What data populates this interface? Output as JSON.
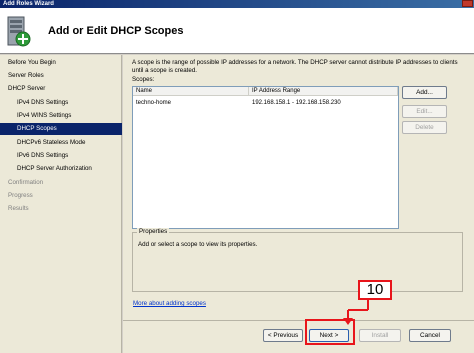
{
  "window": {
    "title": "Add Roles Wizard"
  },
  "header": {
    "title": "Add or Edit DHCP Scopes",
    "icon": "server-add-icon"
  },
  "nav": {
    "items": [
      {
        "label": "Before You Begin",
        "level": "top",
        "state": "normal"
      },
      {
        "label": "Server Roles",
        "level": "top",
        "state": "normal"
      },
      {
        "label": "DHCP Server",
        "level": "top",
        "state": "normal"
      },
      {
        "label": "IPv4 DNS Settings",
        "level": "sub",
        "state": "normal"
      },
      {
        "label": "IPv4 WINS Settings",
        "level": "sub",
        "state": "normal"
      },
      {
        "label": "DHCP Scopes",
        "level": "sub",
        "state": "active"
      },
      {
        "label": "DHCPv6 Stateless Mode",
        "level": "sub",
        "state": "normal"
      },
      {
        "label": "IPv6 DNS Settings",
        "level": "sub",
        "state": "normal"
      },
      {
        "label": "DHCP Server Authorization",
        "level": "sub",
        "state": "normal"
      },
      {
        "label": "Confirmation",
        "level": "top",
        "state": "disabled"
      },
      {
        "label": "Progress",
        "level": "top",
        "state": "disabled"
      },
      {
        "label": "Results",
        "level": "top",
        "state": "disabled"
      }
    ]
  },
  "main": {
    "description": "A scope is the range of possible IP addresses for a network. The DHCP server cannot distribute IP addresses to clients until a scope is created.",
    "scopes_label": "Scopes:",
    "columns": [
      "Name",
      "IP Address Range"
    ],
    "rows": [
      {
        "name": "techno-home",
        "range": "192.168.158.1 - 192.168.158.230"
      }
    ],
    "buttons": {
      "add": "Add...",
      "edit": "Edit...",
      "delete": "Delete"
    },
    "properties": {
      "legend": "Properties",
      "text": "Add or select a scope to view its properties."
    },
    "more_link": "More about adding scopes"
  },
  "footer": {
    "previous": "< Previous",
    "next": "Next >",
    "install": "Install",
    "cancel": "Cancel"
  },
  "annotation": {
    "step_number": "10",
    "color": "#e8151b"
  }
}
